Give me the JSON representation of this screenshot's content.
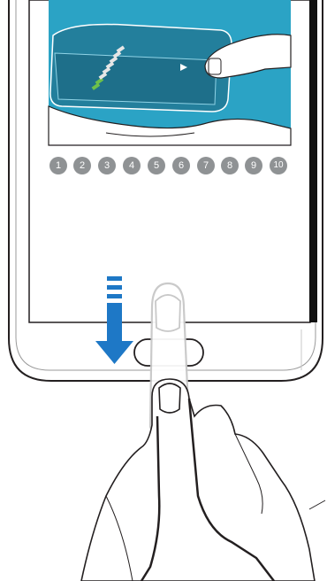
{
  "steps": [
    "1",
    "2",
    "3",
    "4",
    "5",
    "6",
    "7",
    "8",
    "9",
    "10"
  ],
  "icons": {
    "swipe_direction": "arrow-down-icon",
    "gesture": "finger-swipe-icon"
  },
  "colors": {
    "screen_teal": "#2ba3c5",
    "dark_teal": "#1e6f8a",
    "arrow_blue": "#1e78c6",
    "step_dot": "#8f9294",
    "outline": "#231f20"
  }
}
